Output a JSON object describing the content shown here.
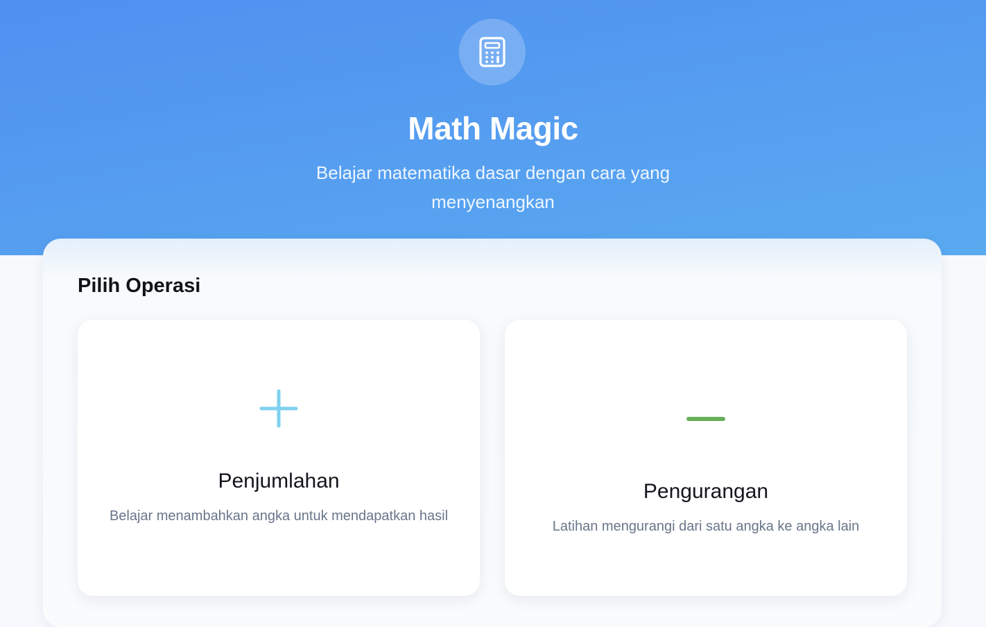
{
  "header": {
    "logo_icon": "calculator-icon",
    "title": "Math Magic",
    "subtitle": "Belajar matematika dasar dengan cara yang menyenangkan"
  },
  "operations": {
    "heading": "Pilih Operasi",
    "items": [
      {
        "icon": "plus-icon",
        "icon_color": "#7fd1ef",
        "title": "Penjumlahan",
        "description": "Belajar menambahkan angka untuk mendapatkan hasil"
      },
      {
        "icon": "minus-icon",
        "icon_color": "#66b05a",
        "title": "Pengurangan",
        "description": "Latihan mengurangi dari satu angka ke angka lain"
      }
    ]
  },
  "colors": {
    "hero_gradient_start": "#5090f0",
    "hero_gradient_end": "#5aaaf0",
    "page_background": "#f7f9fc"
  }
}
